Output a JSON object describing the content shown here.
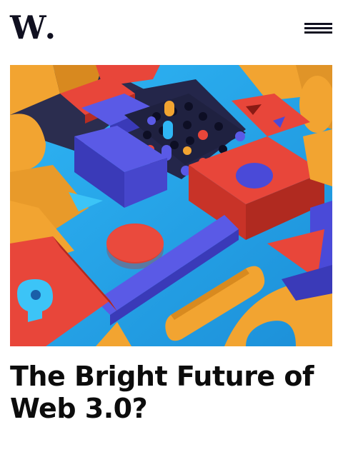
{
  "header": {
    "logo_text": "W",
    "logo_dot": ".",
    "menu_icon": "hamburger-menu-icon"
  },
  "hero": {
    "image_subject": "abstract-3d-colorful-blocks-illustration",
    "colors": {
      "background": "#26a9f0",
      "orange": "#f0a22e",
      "red": "#e8463a",
      "indigo": "#4a4ad8",
      "navy": "#2a2a4a",
      "sky": "#3cc0f5"
    }
  },
  "article": {
    "title": "The Bright Future of Web 3.0?"
  }
}
